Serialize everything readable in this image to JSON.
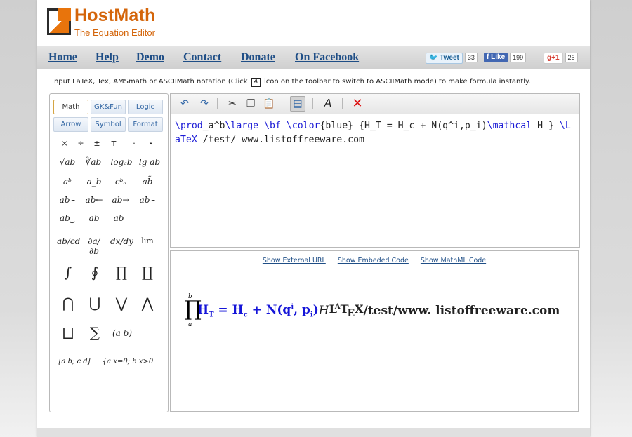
{
  "logo": {
    "title": "HostMath",
    "subtitle": "The Equation Editor"
  },
  "nav": {
    "items": [
      "Home",
      "Help",
      "Demo",
      "Contact",
      "Donate",
      "On Facebook"
    ]
  },
  "social": {
    "tweet_label": "Tweet",
    "tweet_count": "33",
    "like_label": "Like",
    "like_count": "199",
    "gplus_label": "g+1",
    "gplus_count": "26"
  },
  "instructions": {
    "before": "Input LaTeX, Tex, AMSmath or ASCIIMath notation (Click",
    "icon": "A",
    "after": "icon on the toolbar to switch to ASCIIMath mode) to make formula instantly."
  },
  "palette": {
    "tabs": [
      "Math",
      "GK&Fun",
      "Logic",
      "Arrow",
      "Symbol",
      "Format"
    ],
    "active_tab": "Math",
    "rows": [
      [
        "×",
        "÷",
        "±",
        "∓",
        "·",
        "⋆"
      ],
      [
        "√ab",
        "∛ab",
        "logₐb",
        "lg ab"
      ],
      [
        "aᵇ",
        "a_b",
        "cᵇₐ",
        "ab̃"
      ],
      [
        "ab⌢",
        "ab←",
        "ab→",
        "ab⌢"
      ],
      [
        "ab⏟",
        "ab",
        "ab‾"
      ],
      [
        "ab/cd",
        "∂a/∂b",
        "dx/dy",
        "lim"
      ],
      [
        "∫",
        "∮",
        "∏",
        "∐"
      ],
      [
        "⋂",
        "⋃",
        "⋁",
        "⋀"
      ],
      [
        "⨆",
        "∑",
        "(a b)"
      ],
      [
        "[a b; c d]",
        "{a x=0; b x>0"
      ]
    ]
  },
  "toolbar": {
    "icons": [
      "undo-icon",
      "redo-icon",
      "cut-icon",
      "copy-icon",
      "paste-icon",
      "latex-mode-icon",
      "ascii-mode-icon",
      "clear-icon"
    ]
  },
  "editor": {
    "code_parts": [
      {
        "t": "\\prod_a^b\\large \\bf \\color{blue} {H_T = H_c + N(q^i,p_i)\\mathcal H } \\LaTeX /test/ www.listoffreeware.com",
        "kw": false
      }
    ]
  },
  "preview": {
    "links": [
      "Show External URL",
      "Show Embeded Code",
      "Show MathML Code"
    ],
    "formula": {
      "prod_upper": "b",
      "prod_lower": "a",
      "blue_text": "H",
      "tail_text": "/test/www. listoffreeware.com"
    }
  }
}
